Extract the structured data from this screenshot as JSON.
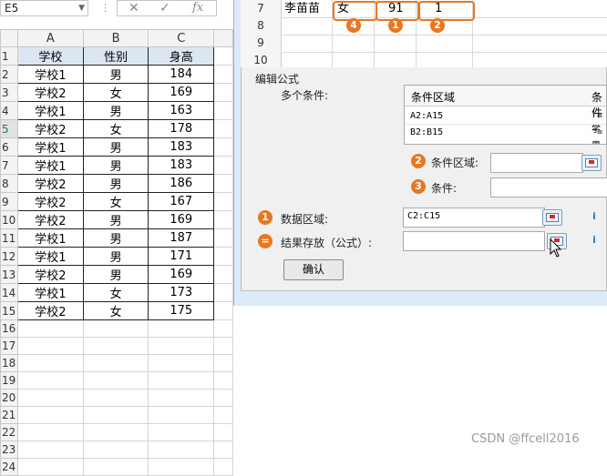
{
  "formula_bar": {
    "name_box": "E5",
    "cancel": "✕",
    "confirm": "✓",
    "fx": "fx"
  },
  "sheet": {
    "columns": [
      "A",
      "B",
      "C"
    ],
    "rows": [
      {
        "n": "1",
        "a": "学校",
        "b": "性别",
        "c": "身高"
      },
      {
        "n": "2",
        "a": "学校1",
        "b": "男",
        "c": "184"
      },
      {
        "n": "3",
        "a": "学校2",
        "b": "女",
        "c": "169"
      },
      {
        "n": "4",
        "a": "学校1",
        "b": "男",
        "c": "163"
      },
      {
        "n": "5",
        "a": "学校2",
        "b": "女",
        "c": "178"
      },
      {
        "n": "6",
        "a": "学校1",
        "b": "男",
        "c": "183"
      },
      {
        "n": "7",
        "a": "学校1",
        "b": "男",
        "c": "183"
      },
      {
        "n": "8",
        "a": "学校2",
        "b": "男",
        "c": "186"
      },
      {
        "n": "9",
        "a": "学校2",
        "b": "女",
        "c": "167"
      },
      {
        "n": "10",
        "a": "学校2",
        "b": "男",
        "c": "169"
      },
      {
        "n": "11",
        "a": "学校1",
        "b": "男",
        "c": "187"
      },
      {
        "n": "12",
        "a": "学校1",
        "b": "男",
        "c": "171"
      },
      {
        "n": "13",
        "a": "学校2",
        "b": "男",
        "c": "169"
      },
      {
        "n": "14",
        "a": "学校1",
        "b": "女",
        "c": "173"
      },
      {
        "n": "15",
        "a": "学校2",
        "b": "女",
        "c": "175"
      },
      {
        "n": "16",
        "a": "",
        "b": "",
        "c": ""
      },
      {
        "n": "17",
        "a": "",
        "b": "",
        "c": ""
      },
      {
        "n": "18",
        "a": "",
        "b": "",
        "c": ""
      },
      {
        "n": "19",
        "a": "",
        "b": "",
        "c": ""
      },
      {
        "n": "20",
        "a": "",
        "b": "",
        "c": ""
      },
      {
        "n": "21",
        "a": "",
        "b": "",
        "c": ""
      },
      {
        "n": "22",
        "a": "",
        "b": "",
        "c": ""
      },
      {
        "n": "23",
        "a": "",
        "b": "",
        "c": ""
      },
      {
        "n": "24",
        "a": "",
        "b": "",
        "c": ""
      }
    ]
  },
  "preview": {
    "rows": [
      {
        "n": "7",
        "c1": "李苗苗",
        "c2": "女",
        "c3": "91",
        "c4": "1"
      },
      {
        "n": "8"
      },
      {
        "n": "9"
      },
      {
        "n": "10"
      }
    ],
    "badges": [
      "4",
      "1",
      "2"
    ]
  },
  "editor": {
    "section_title": "编辑公式",
    "multi_label": "多个条件:",
    "cond_header_1": "条件区域",
    "cond_header_2": "条件",
    "cond_rows": [
      {
        "range": "A2:A15",
        "crit": "\"=学"
      },
      {
        "range": "B2:B15",
        "crit": "\"=男"
      }
    ],
    "cond_range_label": "条件区域:",
    "cond_label": "条件:",
    "data_range_label": "数据区域:",
    "data_range_value": "C2:C15",
    "result_label": "结果存放（公式）:",
    "badge_2": "2",
    "badge_3": "3",
    "badge_1": "1",
    "badge_eq": "=",
    "ok_label": "确认"
  },
  "watermark": "CSDN @ffcell2016"
}
